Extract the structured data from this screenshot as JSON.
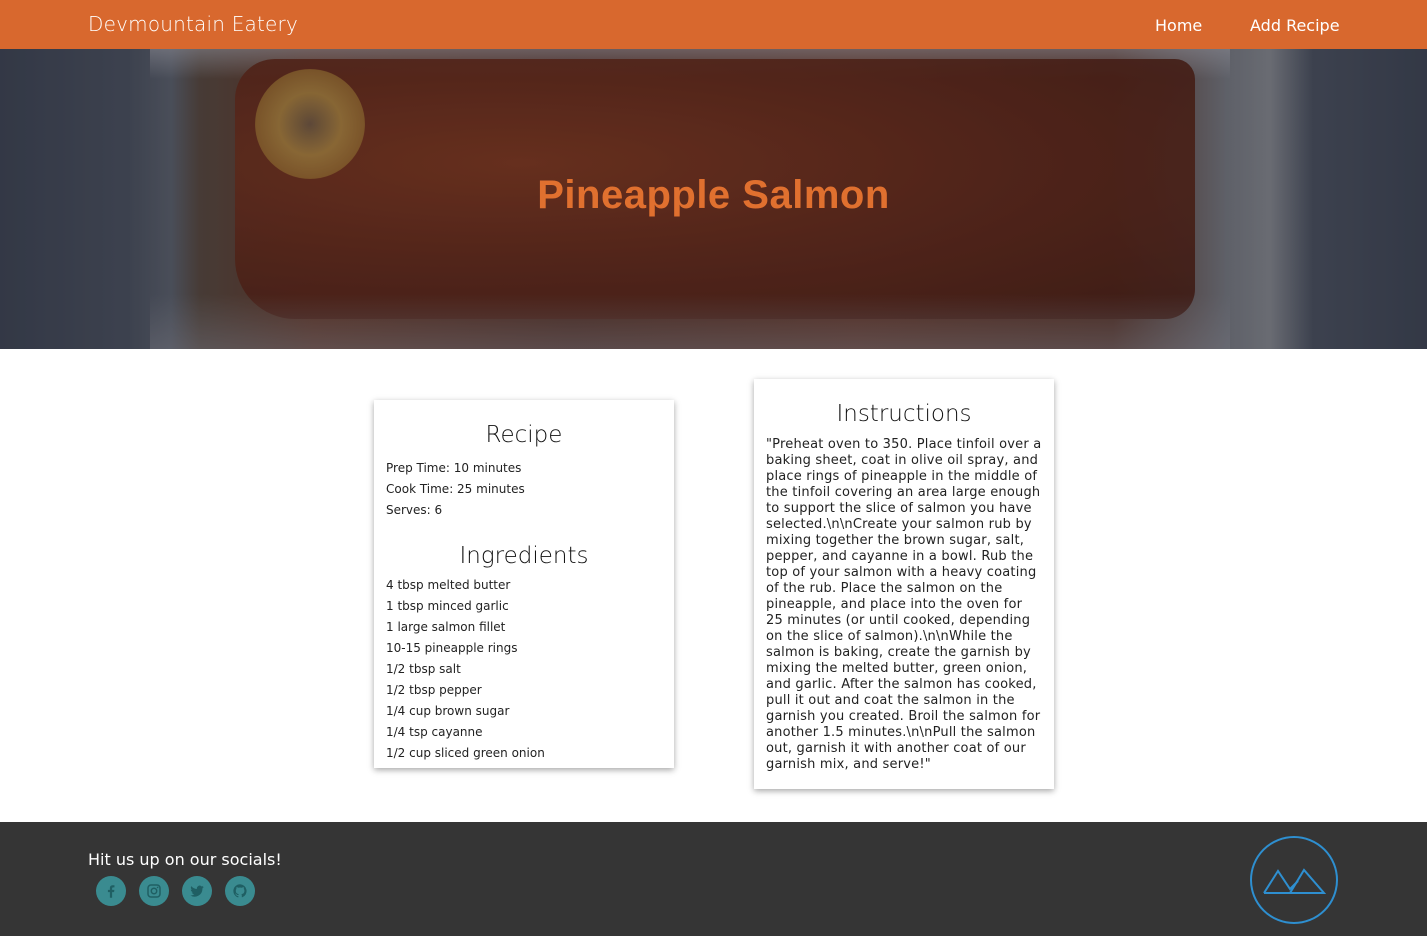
{
  "nav": {
    "brand": "Devmountain Eatery",
    "links": [
      "Home",
      "Add Recipe"
    ]
  },
  "hero": {
    "title": "Pineapple Salmon"
  },
  "recipe": {
    "heading": "Recipe",
    "prep_time": "Prep Time: 10 minutes",
    "cook_time": "Cook Time: 25 minutes",
    "serves": "Serves: 6",
    "ingredients_heading": "Ingredients",
    "ingredients": [
      "4 tbsp melted butter",
      "1 tbsp minced garlic",
      "1 large salmon fillet",
      "10-15 pineapple rings",
      "1/2 tbsp salt",
      "1/2 tbsp pepper",
      "1/4 cup brown sugar",
      "1/4 tsp cayanne",
      "1/2 cup sliced green onion"
    ]
  },
  "instructions": {
    "heading": "Instructions",
    "text": "\"Preheat oven to 350. Place tinfoil over a baking sheet, coat in olive oil spray, and place rings of pineapple in the middle of the tinfoil covering an area large enough to support the slice of salmon you have selected.\\n\\nCreate your salmon rub by mixing together the brown sugar, salt, pepper, and cayanne in a bowl. Rub the top of your salmon with a heavy coating of the rub. Place the salmon on the pineapple, and place into the oven for 25 minutes (or until cooked, depending on the slice of salmon).\\n\\nWhile the salmon is baking, create the garnish by mixing the melted butter, green onion, and garlic. After the salmon has cooked, pull it out and coat the salmon in the garnish you created. Broil the salmon for another 1.5 minutes.\\n\\nPull the salmon out, garnish it with another coat of our garnish mix, and serve!\""
  },
  "footer": {
    "text": "Hit us up on our socials!",
    "socials": [
      "facebook-icon",
      "instagram-icon",
      "twitter-icon",
      "github-icon"
    ],
    "logo": "mountain-logo-icon"
  },
  "colors": {
    "nav_bg": "#d8682e",
    "title": "#e0702f",
    "footer_bg": "#353535",
    "social_bg": "#3a8b90",
    "logo_stroke": "#2e8fd0"
  }
}
